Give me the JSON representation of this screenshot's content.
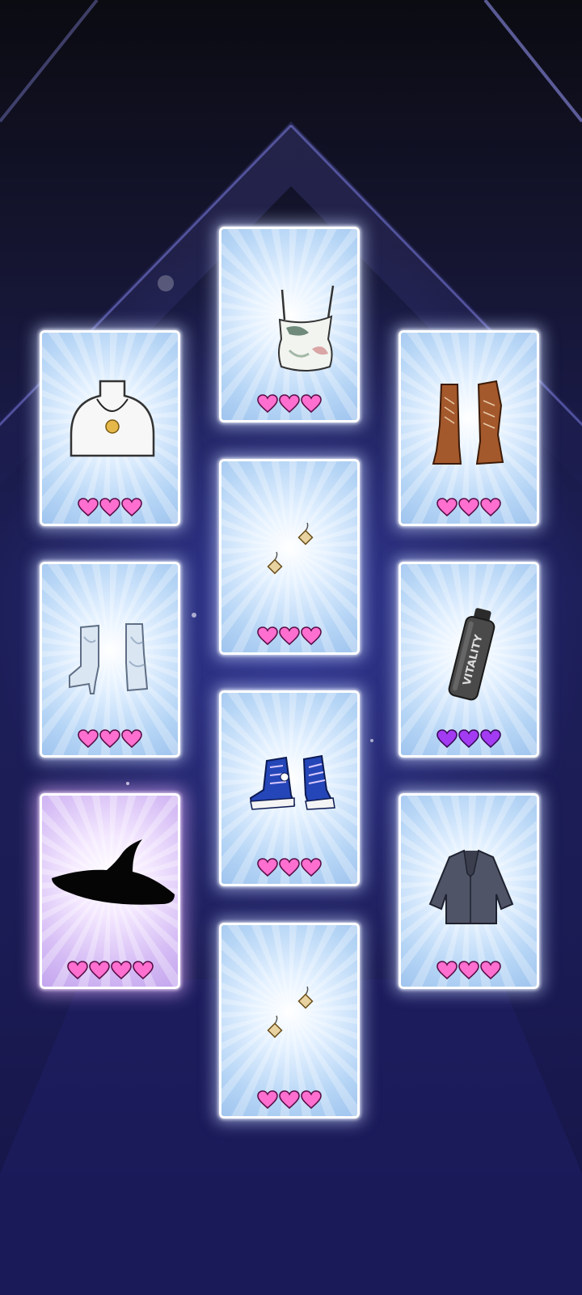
{
  "colors": {
    "heart_pink": "#ff6fd0",
    "heart_purple": "#a23bf2",
    "card_border": "#ffffff",
    "legendary_tint": "#d6bdf5"
  },
  "cards": [
    {
      "id": "tank-top",
      "icon": "floral-tank-top-icon",
      "hearts": 3,
      "heart_color": "pink",
      "rarity": "rare"
    },
    {
      "id": "necklace",
      "icon": "pendant-necklace-icon",
      "hearts": 3,
      "heart_color": "pink",
      "rarity": "rare"
    },
    {
      "id": "lace-up-boots",
      "icon": "brown-lace-up-boots-icon",
      "hearts": 3,
      "heart_color": "pink",
      "rarity": "rare"
    },
    {
      "id": "earrings-1",
      "icon": "earrings-icon",
      "hearts": 3,
      "heart_color": "pink",
      "rarity": "rare"
    },
    {
      "id": "silver-boots",
      "icon": "silver-ankle-boots-icon",
      "hearts": 3,
      "heart_color": "pink",
      "rarity": "rare"
    },
    {
      "id": "water-bottle",
      "icon": "water-bottle-icon",
      "hearts": 3,
      "heart_color": "purple",
      "rarity": "epic"
    },
    {
      "id": "sneakers",
      "icon": "blue-sneakers-icon",
      "hearts": 3,
      "heart_color": "pink",
      "rarity": "rare"
    },
    {
      "id": "witch-hat",
      "icon": "witch-hat-silhouette-icon",
      "hearts": 4,
      "heart_color": "pink",
      "rarity": "legendary"
    },
    {
      "id": "blazer",
      "icon": "gray-blazer-icon",
      "hearts": 3,
      "heart_color": "pink",
      "rarity": "rare"
    },
    {
      "id": "earrings-2",
      "icon": "earrings-icon",
      "hearts": 3,
      "heart_color": "pink",
      "rarity": "rare"
    }
  ],
  "bottle_print": "VITALITY"
}
